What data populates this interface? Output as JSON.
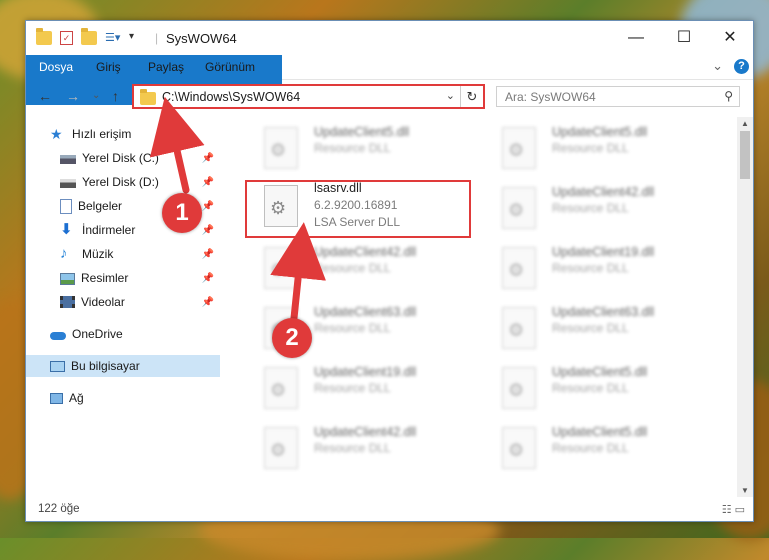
{
  "window": {
    "title": "SysWOW64",
    "minimize": "—",
    "maximize": "☐",
    "close": "✕"
  },
  "ribbon": {
    "tabs": [
      "Dosya",
      "Giriş",
      "Paylaş",
      "Görünüm"
    ],
    "help": "?",
    "expand": "⌄"
  },
  "nav": {
    "back": "←",
    "forward": "→",
    "recent": "⌄",
    "up": "↑",
    "path": "C:\\Windows\\SysWOW64",
    "refresh": "↻"
  },
  "search": {
    "placeholder": "Ara: SysWOW64",
    "icon": "⚲"
  },
  "sidebar": {
    "items": [
      {
        "label": "Hızlı erişim",
        "icon": "star-icon",
        "pinned": false
      },
      {
        "label": "Yerel Disk (C:)",
        "icon": "drive-icon",
        "pinned": true
      },
      {
        "label": "Yerel Disk (D:)",
        "icon": "drive-icon",
        "pinned": true
      },
      {
        "label": "Belgeler",
        "icon": "document-icon",
        "pinned": true
      },
      {
        "label": "İndirmeler",
        "icon": "download-icon",
        "pinned": true
      },
      {
        "label": "Müzik",
        "icon": "music-icon",
        "pinned": true
      },
      {
        "label": "Resimler",
        "icon": "picture-icon",
        "pinned": true
      },
      {
        "label": "Videolar",
        "icon": "video-icon",
        "pinned": true
      },
      {
        "label": "OneDrive",
        "icon": "cloud-icon",
        "pinned": false
      },
      {
        "label": "Bu bilgisayar",
        "icon": "computer-icon",
        "pinned": false
      },
      {
        "label": "Ağ",
        "icon": "network-icon",
        "pinned": false
      }
    ],
    "pin_glyph": "📌"
  },
  "files": [
    {
      "name": "UpdateClient5.dll",
      "desc": "Resource DLL",
      "blur": true
    },
    {
      "name": "UpdateClient5.dll",
      "desc": "Resource DLL",
      "blur": true
    },
    {
      "name": "lsasrv.dll",
      "version": "6.2.9200.16891",
      "desc": "LSA Server DLL",
      "blur": false
    },
    {
      "name": "UpdateClient42.dll",
      "desc": "Resource DLL",
      "blur": true
    },
    {
      "name": "UpdateClient42.dll",
      "desc": "Resource DLL",
      "blur": true
    },
    {
      "name": "UpdateClient19.dll",
      "desc": "Resource DLL",
      "blur": true
    },
    {
      "name": "UpdateClient63.dll",
      "desc": "Resource DLL",
      "blur": true
    },
    {
      "name": "UpdateClient63.dll",
      "desc": "Resource DLL",
      "blur": true
    },
    {
      "name": "UpdateClient19.dll",
      "desc": "Resource DLL",
      "blur": true
    },
    {
      "name": "UpdateClient5.dll",
      "desc": "Resource DLL",
      "blur": true
    },
    {
      "name": "UpdateClient42.dll",
      "desc": "Resource DLL",
      "blur": true
    },
    {
      "name": "UpdateClient5.dll",
      "desc": "Resource DLL",
      "blur": true
    }
  ],
  "status": {
    "count": "122 öğe",
    "views": "☷ ▭"
  },
  "callouts": [
    "1",
    "2"
  ],
  "colors": {
    "accent": "#1979ca",
    "highlight": "#e03a3a",
    "selection": "#cce4f7"
  }
}
